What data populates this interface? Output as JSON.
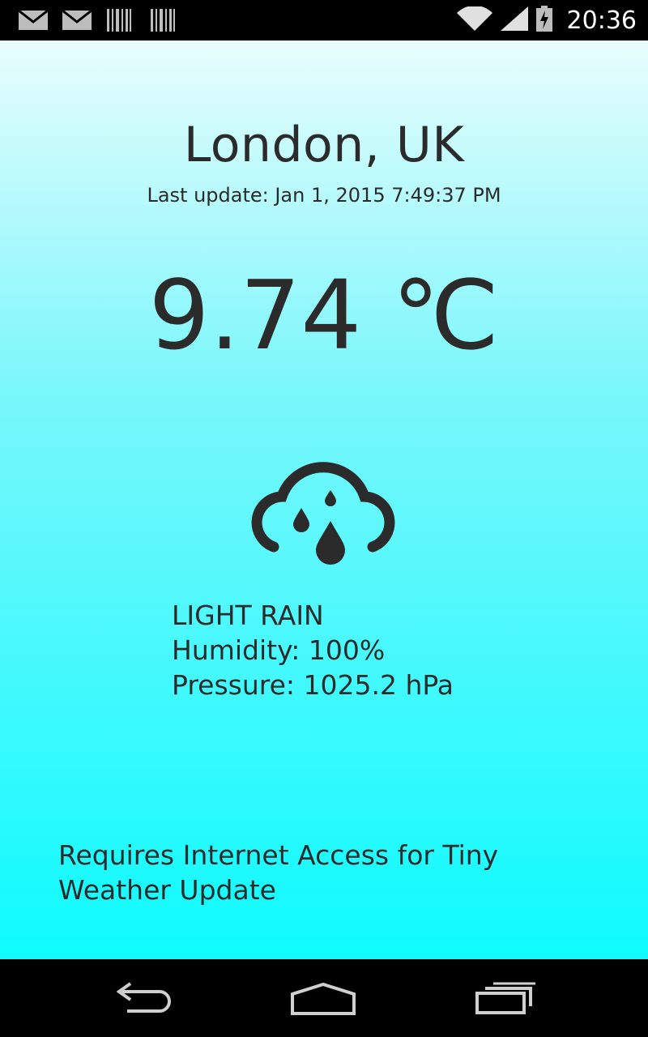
{
  "status_bar": {
    "time": "20:36",
    "icons": [
      "gmail-icon",
      "gmail-icon",
      "barcode-icon",
      "barcode-icon",
      "wifi-icon",
      "signal-icon",
      "battery-icon"
    ]
  },
  "weather": {
    "city": "London, UK",
    "last_update": "Last update: Jan 1, 2015 7:49:37 PM",
    "temperature": "9.74 ℃",
    "icon": "rain-cloud-icon",
    "description": "LIGHT RAIN",
    "humidity": "Humidity: 100%",
    "pressure": "Pressure: 1025.2 hPa"
  },
  "notice": "Requires Internet Access for Tiny Weather Update",
  "nav_bar": {
    "icons": [
      "back-icon",
      "home-icon",
      "recents-icon"
    ]
  },
  "colors": {
    "text": "#2b2b2b",
    "gradient_top": "#e9fdfd",
    "gradient_bottom": "#0dfbff"
  }
}
